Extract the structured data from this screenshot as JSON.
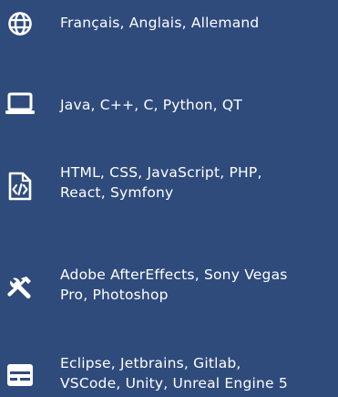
{
  "items": [
    {
      "icon": "globe-icon",
      "text": "Français, Anglais, Allemand"
    },
    {
      "icon": "laptop-icon",
      "text": "Java, C++, C, Python, QT"
    },
    {
      "icon": "code-file-icon",
      "text": "HTML, CSS, JavaScript, PHP,\nReact, Symfony"
    },
    {
      "icon": "tools-icon",
      "text": "Adobe AfterEffects, Sony Vegas\nPro, Photoshop"
    },
    {
      "icon": "window-icon",
      "text": "Eclipse, Jetbrains, Gitlab,\nVSCode, Unity, Unreal Engine 5"
    }
  ]
}
